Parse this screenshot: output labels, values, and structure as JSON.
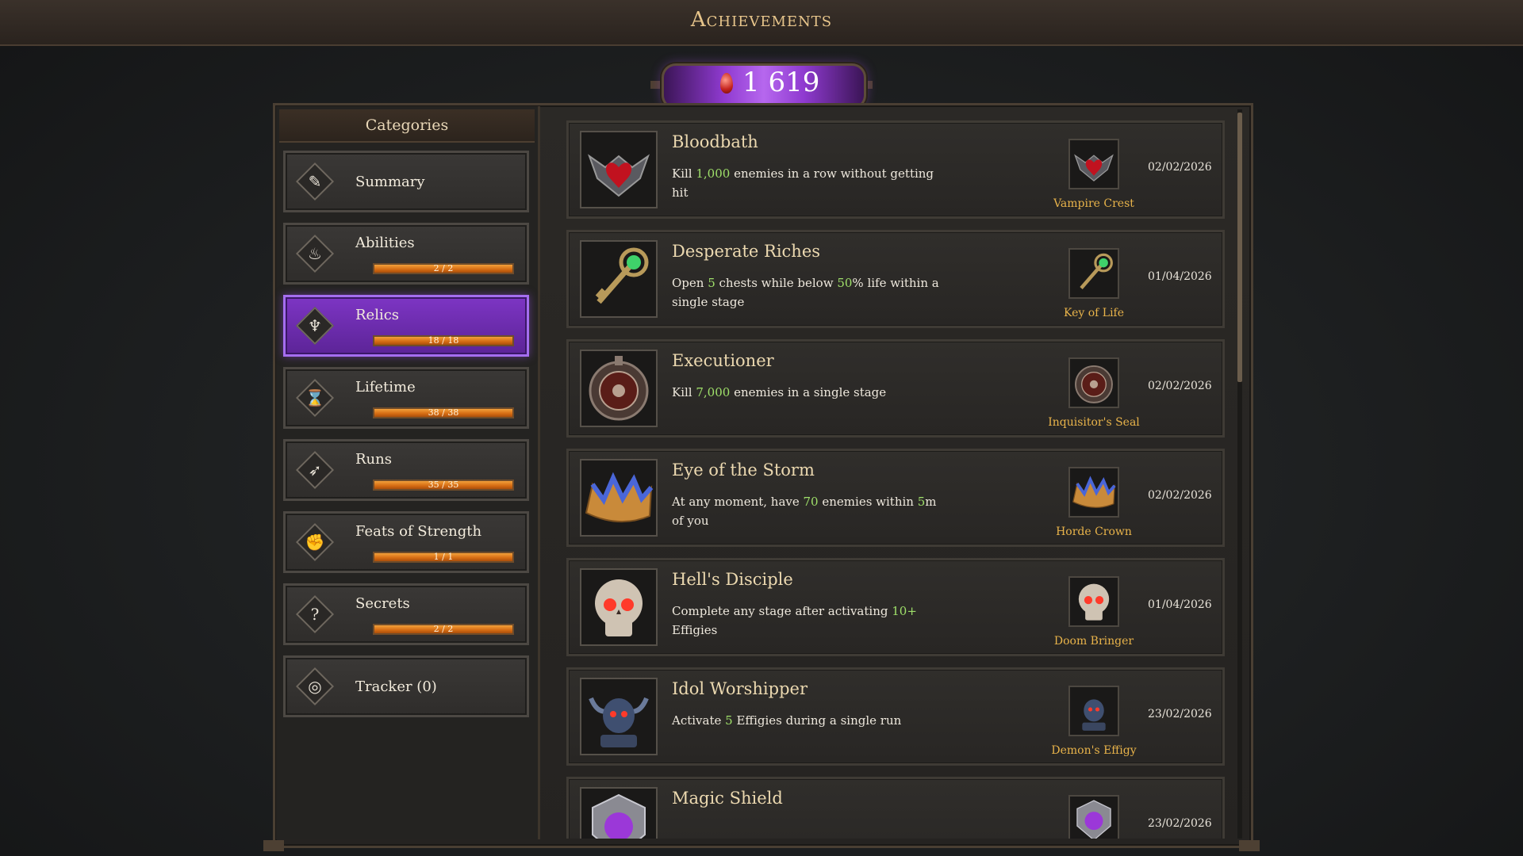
{
  "header": {
    "title": "Achievements"
  },
  "score": {
    "value": "1 619"
  },
  "categories": {
    "title": "Categories",
    "items": [
      {
        "label": "Summary"
      },
      {
        "label": "Abilities",
        "progress": "2 / 2",
        "fraction": 1.0
      },
      {
        "label": "Relics",
        "progress": "18 / 18",
        "fraction": 1.0
      },
      {
        "label": "Lifetime",
        "progress": "38 / 38",
        "fraction": 1.0
      },
      {
        "label": "Runs",
        "progress": "35 / 35",
        "fraction": 1.0
      },
      {
        "label": "Feats of Strength",
        "progress": "1 / 1",
        "fraction": 1.0
      },
      {
        "label": "Secrets",
        "progress": "2 / 2",
        "fraction": 1.0
      },
      {
        "label": "Tracker (0)"
      }
    ],
    "selected": "Relics"
  },
  "achievements": [
    {
      "name": "Bloodbath",
      "desc": [
        "Kill ",
        "1,000",
        " enemies in a row without getting hit"
      ],
      "reward": "Vampire Crest",
      "date": "02/02/2026",
      "icon": "vampire-crest-icon"
    },
    {
      "name": "Desperate Riches",
      "desc": [
        "Open ",
        "5",
        " chests while below ",
        "50",
        "% life within a single stage"
      ],
      "reward": "Key of Life",
      "date": "01/04/2026",
      "icon": "key-of-life-icon"
    },
    {
      "name": "Executioner",
      "desc": [
        "Kill ",
        "7,000",
        " enemies in a single stage"
      ],
      "reward": "Inquisitor's Seal",
      "date": "02/02/2026",
      "icon": "inquisitors-seal-icon"
    },
    {
      "name": "Eye of the Storm",
      "desc": [
        "At any moment, have ",
        "70",
        " enemies within ",
        "5",
        "m of you"
      ],
      "reward": "Horde Crown",
      "date": "02/02/2026",
      "icon": "horde-crown-icon"
    },
    {
      "name": "Hell's Disciple",
      "desc": [
        "Complete any stage after activating ",
        "10+",
        " Effigies"
      ],
      "reward": "Doom Bringer",
      "date": "01/04/2026",
      "icon": "doom-bringer-icon"
    },
    {
      "name": "Idol Worshipper",
      "desc": [
        "Activate ",
        "5",
        " Effigies during a single run"
      ],
      "reward": "Demon's Effigy",
      "date": "23/02/2026",
      "icon": "demons-effigy-icon"
    },
    {
      "name": "Magic Shield",
      "desc": [],
      "reward": "",
      "date": "23/02/2026",
      "icon": "magic-shield-icon"
    }
  ],
  "colors": {
    "accent": "#e7c58b",
    "highlight": "#9fe06a",
    "reward": "#e8b34a",
    "selected": "#7d35c4",
    "progress": "#e08a22"
  }
}
